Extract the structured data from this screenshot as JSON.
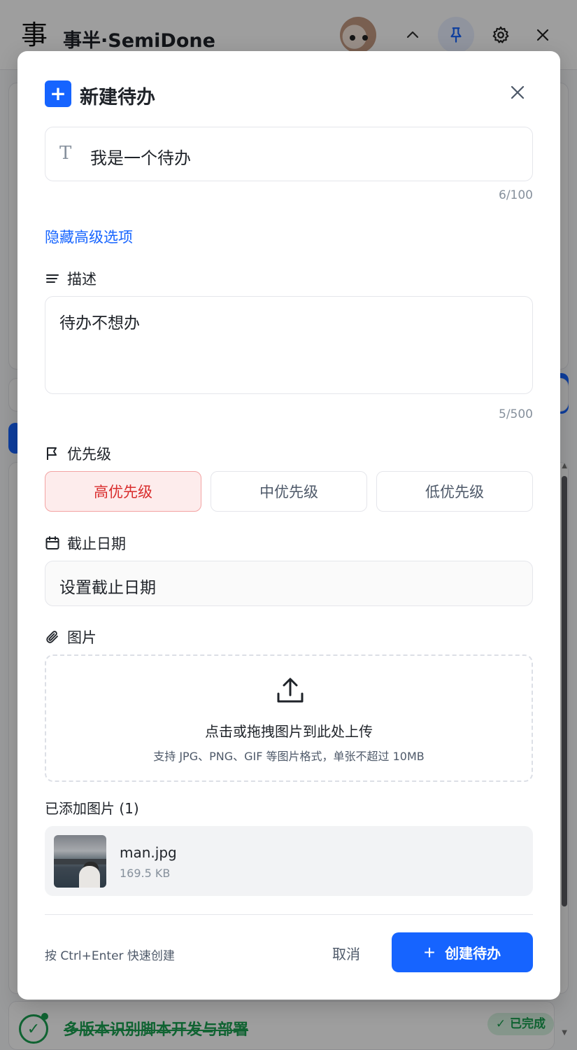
{
  "app": {
    "logo": "事",
    "title": "事半·SemiDone"
  },
  "background_task": {
    "title": "多版本识别脚本开发与部署",
    "status_badge": "✓ 已完成"
  },
  "modal": {
    "title": "新建待办",
    "title_input": {
      "value": "我是一个待办",
      "counter": "6/100"
    },
    "advanced_toggle": "隐藏高级选项",
    "description": {
      "label": "描述",
      "value": "待办不想办",
      "counter": "5/500"
    },
    "priority": {
      "label": "优先级",
      "options": [
        "高优先级",
        "中优先级",
        "低优先级"
      ],
      "selected": "高优先级"
    },
    "due_date": {
      "label": "截止日期",
      "placeholder": "设置截止日期"
    },
    "images": {
      "label": "图片",
      "upload_main": "点击或拖拽图片到此处上传",
      "upload_sub": "支持 JPG、PNG、GIF 等图片格式，单张不超过 10MB",
      "added_label": "已添加图片 (1)",
      "files": [
        {
          "name": "man.jpg",
          "size": "169.5 KB"
        }
      ]
    },
    "footer": {
      "hint": "按 Ctrl+Enter 快速创建",
      "cancel": "取消",
      "create": "创建待办"
    }
  },
  "colors": {
    "primary": "#1664ff",
    "priority_high_bg": "#fdecec",
    "priority_high_text": "#d92d2d",
    "success": "#1aa151"
  }
}
